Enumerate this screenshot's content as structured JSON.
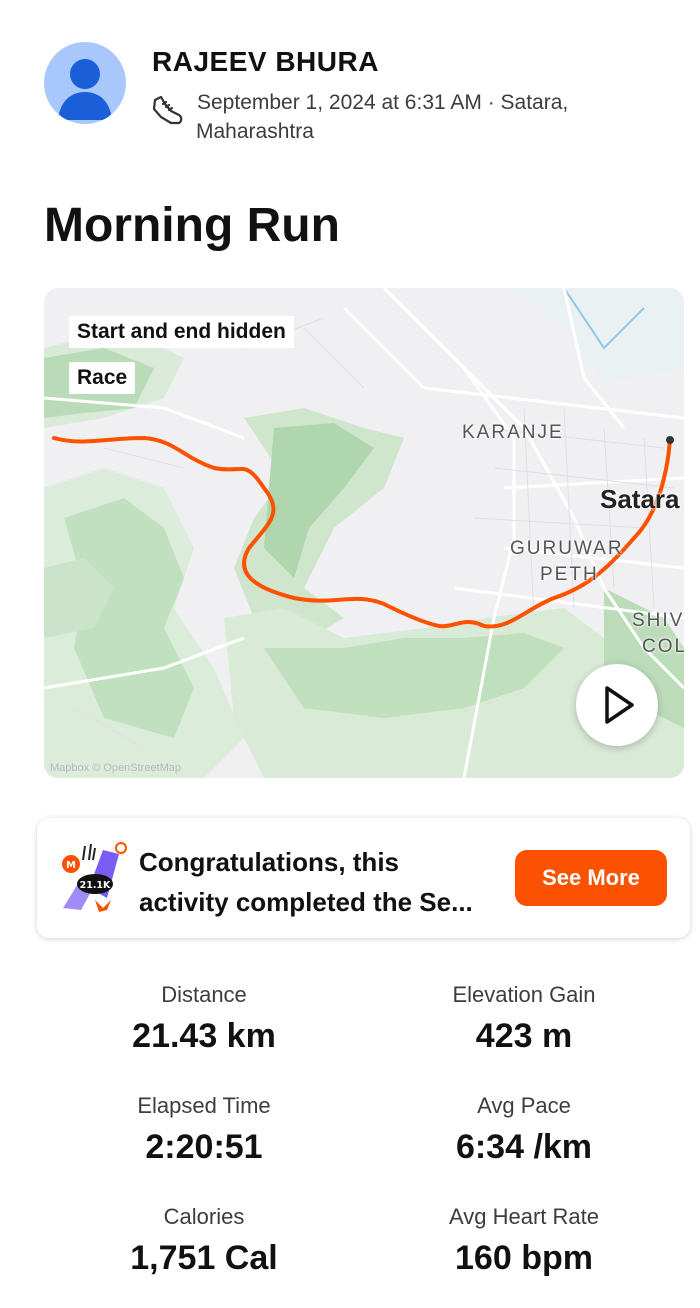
{
  "athlete": {
    "name": "RAJEEV BHURA",
    "date": "September 1, 2024 at 6:31 AM · Satara,",
    "location_cont": "Maharashtra"
  },
  "activity": {
    "title": "Morning Run"
  },
  "map": {
    "tags": [
      "Start and end hidden",
      "Race"
    ],
    "places": {
      "karanje": "KARANJE",
      "satara": "Satara",
      "guruwar": "GURUWAR",
      "peth": "PETH",
      "shiv": "SHIV",
      "col": "COL"
    },
    "attribution": "Mapbox © OpenStreetMap",
    "route_color": "#fc5200"
  },
  "achievement": {
    "line1": "Congratulations, this",
    "line2": "activity completed the Se...",
    "badge_text": "21.1K",
    "button_label": "See More",
    "button_color": "#fc5200"
  },
  "stats": [
    {
      "label": "Distance",
      "value": "21.43 km"
    },
    {
      "label": "Elevation Gain",
      "value": "423 m"
    },
    {
      "label": "Elapsed Time",
      "value": "2:20:51"
    },
    {
      "label": "Avg Pace",
      "value": "6:34 /km"
    },
    {
      "label": "Calories",
      "value": "1,751 Cal"
    },
    {
      "label": "Avg Heart Rate",
      "value": "160 bpm"
    }
  ]
}
